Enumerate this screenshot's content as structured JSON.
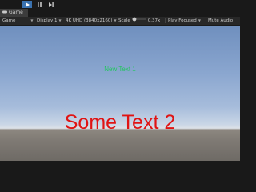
{
  "playbar": {
    "play_icon": "play-icon",
    "pause_icon": "pause-icon",
    "step_icon": "step-icon",
    "accent_color": "#3a72b0"
  },
  "tabs": [
    {
      "label": "Game",
      "icon": "game-controller-icon"
    }
  ],
  "toolbar": {
    "mode_dropdown": "Game",
    "display_dropdown": "Display 1",
    "resolution_dropdown": "4K UHD (3840x2160)",
    "scale_label": "Scale",
    "scale_value": "0.37x",
    "play_focused_dropdown": "Play Focused",
    "mute_audio_label": "Mute Audio"
  },
  "scene": {
    "text_small": "New Text 1",
    "text_small_color": "#22c55e",
    "text_large": "Some Text 2",
    "text_large_color": "#e01414"
  }
}
